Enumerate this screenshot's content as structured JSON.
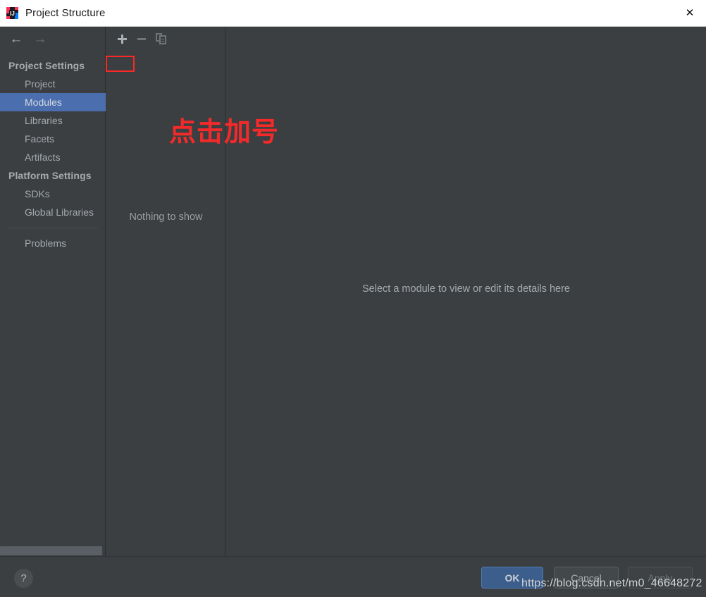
{
  "window": {
    "title": "Project Structure",
    "app_icon": "intellij-idea-logo-icon",
    "close_icon": "✕"
  },
  "sidebar": {
    "back_icon": "←",
    "forward_icon": "→",
    "nav": [
      {
        "kind": "group",
        "label": "Project Settings",
        "name": "project-settings"
      },
      {
        "kind": "item",
        "label": "Project",
        "name": "project",
        "selected": false
      },
      {
        "kind": "item",
        "label": "Modules",
        "name": "modules",
        "selected": true
      },
      {
        "kind": "item",
        "label": "Libraries",
        "name": "libraries",
        "selected": false
      },
      {
        "kind": "item",
        "label": "Facets",
        "name": "facets",
        "selected": false
      },
      {
        "kind": "item",
        "label": "Artifacts",
        "name": "artifacts",
        "selected": false
      },
      {
        "kind": "group",
        "label": "Platform Settings",
        "name": "platform-settings"
      },
      {
        "kind": "item",
        "label": "SDKs",
        "name": "sdks",
        "selected": false
      },
      {
        "kind": "item",
        "label": "Global Libraries",
        "name": "global-libraries",
        "selected": false
      },
      {
        "kind": "separator",
        "label": "",
        "name": "divider"
      },
      {
        "kind": "item",
        "label": "Problems",
        "name": "problems",
        "selected": false
      }
    ]
  },
  "modules_panel": {
    "toolbar": {
      "add_icon": "plus-icon",
      "add_tooltip": "Add",
      "remove_icon": "minus-icon",
      "remove_tooltip": "Remove",
      "copy_icon": "copy-icon",
      "copy_tooltip": "Copy"
    },
    "empty_text": "Nothing to show"
  },
  "details_panel": {
    "hint": "Select a module to view or edit its details here"
  },
  "annotation": {
    "text": "点击加号",
    "color": "#f42a2a",
    "highlight_target": "add-module-button"
  },
  "footer": {
    "help_label": "?",
    "ok_label": "OK",
    "cancel_label": "Cancel",
    "apply_label": "Apply"
  },
  "watermark": {
    "text": "https://blog.csdn.net/m0_46648272"
  },
  "colors": {
    "window_background": "#3c3f41",
    "titlebar_background": "#ffffff",
    "selection_blue": "#4b6eaf",
    "ok_button_blue": "#3c5e8c",
    "annotation_red": "#f42a2a",
    "highlight_border_red": "#fc2828",
    "text_primary": "#a3a9ae",
    "text_muted": "#73797d"
  }
}
